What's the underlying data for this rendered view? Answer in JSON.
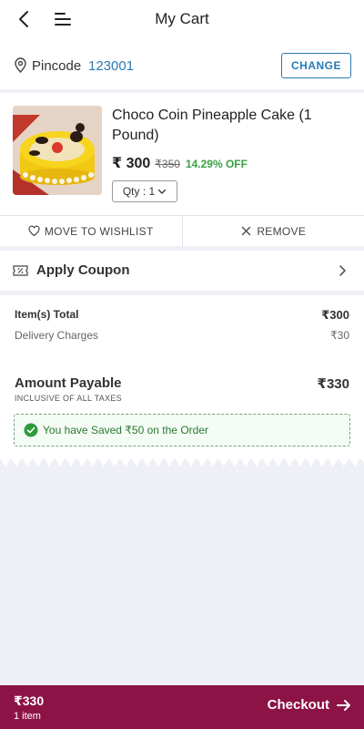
{
  "header": {
    "title": "My Cart",
    "back_icon": "arrow-left-icon",
    "menu_icon": "menu-icon"
  },
  "pincode": {
    "icon": "location-pin-icon",
    "label": "Pincode",
    "value": "123001",
    "change_label": "CHANGE"
  },
  "product": {
    "image_icon": "cake-image",
    "name": "Choco Coin Pineapple Cake (1 Pound)",
    "price": "₹ 300",
    "mrp": "₹350",
    "discount": "14.29% OFF",
    "qty_label": "Qty : 1",
    "wishlist_label": "MOVE TO WISHLIST",
    "remove_label": "REMOVE"
  },
  "coupon": {
    "icon": "coupon-icon",
    "label": "Apply Coupon"
  },
  "summary": {
    "items_total_label": "Item(s) Total",
    "items_total_value": "₹300",
    "delivery_label": "Delivery Charges",
    "delivery_value": "₹30",
    "payable_label": "Amount Payable",
    "payable_value": "₹330",
    "taxes_note": "INCLUSIVE OF ALL TAXES",
    "saved_text": "You have Saved ₹50 on the Order"
  },
  "footer": {
    "total": "₹330",
    "items": "1 item",
    "checkout_label": "Checkout"
  },
  "colors": {
    "accent": "#8c1345",
    "link": "#2a7ab3",
    "success": "#3aa145"
  }
}
